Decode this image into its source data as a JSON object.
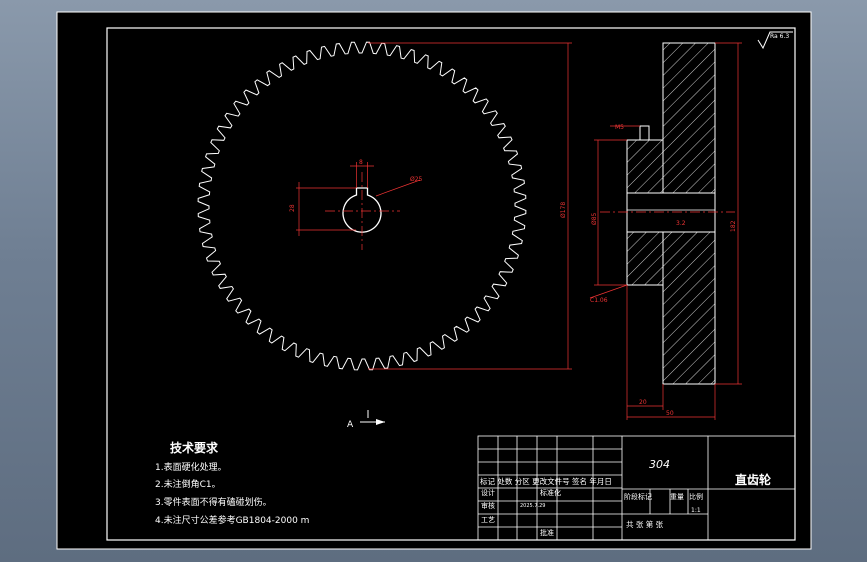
{
  "drawing": {
    "roughness": "Ra 6.3",
    "view_label": "A",
    "dimensions": {
      "key_width": "8",
      "bore_dia": "Ø25",
      "keyway_depth": "28",
      "tip_dia": "Ø178",
      "hub_dia": "Ø85",
      "chamfer": "C1.06",
      "tooth_width": "20",
      "total_width": "50",
      "outer_dia": "182",
      "key_label": "M5",
      "bore_roughness": "3.2"
    }
  },
  "tech_requirements": {
    "title": "技术要求",
    "items": [
      "1.表面硬化处理。",
      "2.未注倒角C1。",
      "3.零件表面不得有磕碰划伤。",
      "4.未注尺寸公差参考GB1804-2000 m"
    ]
  },
  "title_block": {
    "material": "304",
    "part_name": "直齿轮",
    "header_row": "标记 处数 分区 更改文件号 签名 年月日",
    "design_label": "设计",
    "design_std": "标准化",
    "check_label": "审核",
    "process_label": "工艺",
    "approve_label": "批准",
    "date": "2025.7.29",
    "stage_label": "阶段标记",
    "weight_label": "重量",
    "scale_label": "比例",
    "scale_value": "1:1",
    "sheet_text": "共   张   第   张"
  }
}
